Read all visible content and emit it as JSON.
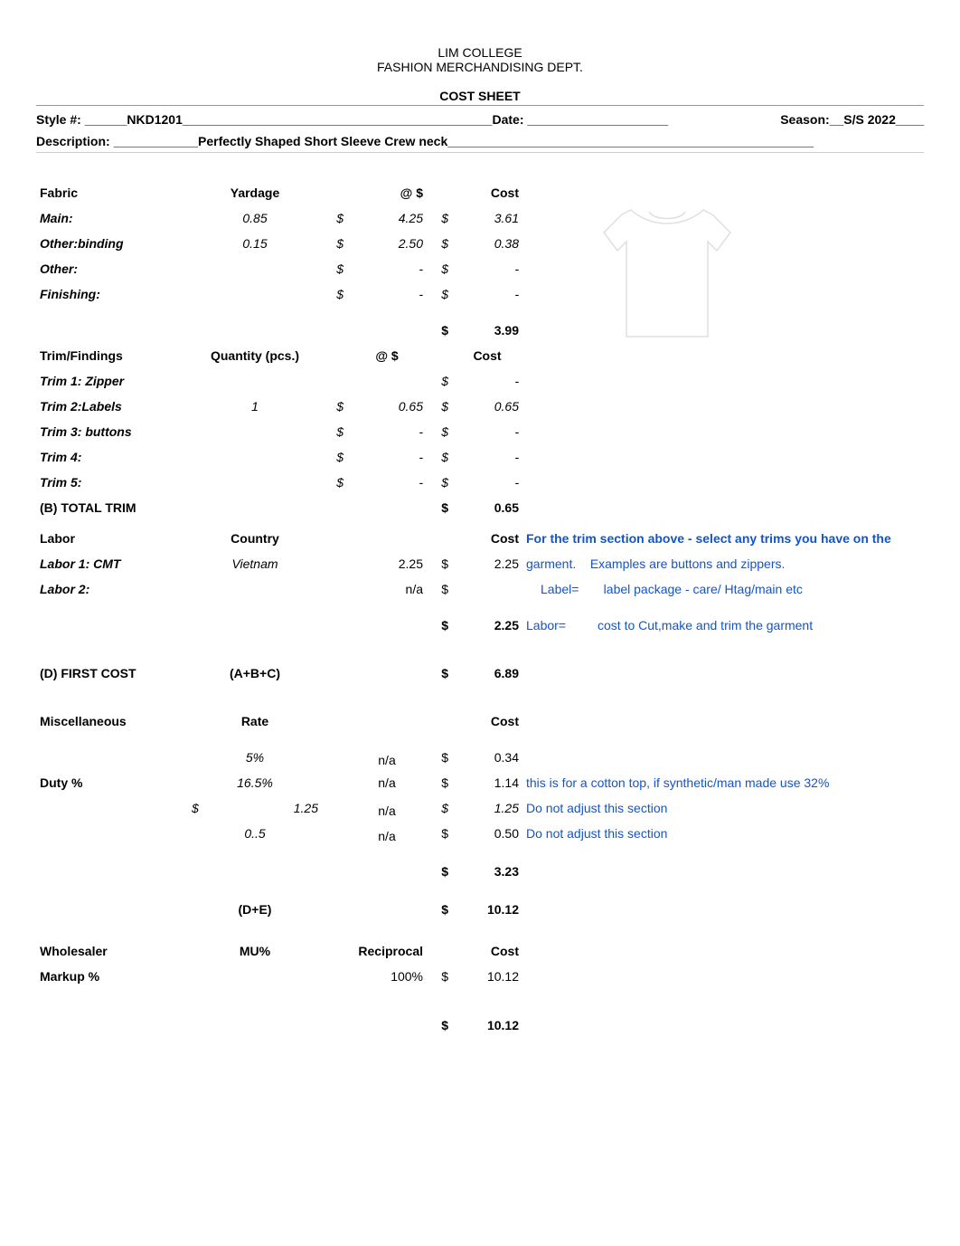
{
  "header": {
    "line1": "LIM COLLEGE",
    "line2": "FASHION MERCHANDISING DEPT."
  },
  "title": "COST SHEET",
  "meta": {
    "style_label": "Style #: ______",
    "style_value": "NKD1201",
    "style_trail": "____________________________________________",
    "date_label": " Date: ____________________",
    "season_label": "Season:__",
    "season_value": "S/S 2022____",
    "desc_label": "Description: ____________",
    "desc_value": "Perfectly Shaped Short Sleeve Crew neck",
    "desc_trail": "____________________________________________________"
  },
  "fabric": {
    "head_fabric": "Fabric",
    "head_yardage": "Yardage",
    "head_at": "@ $",
    "head_cost": "Cost",
    "rows": [
      {
        "label": "Main:",
        "yardage": "0.85",
        "rate": "4.25",
        "cost": "3.61"
      },
      {
        "label": "Other:binding",
        "yardage": "0.15",
        "rate": "2.50",
        "cost": "0.38"
      },
      {
        "label": "Other:",
        "yardage": "",
        "rate": "-",
        "cost": "-"
      },
      {
        "label": "Finishing:",
        "yardage": "",
        "rate": "-",
        "cost": "-"
      }
    ],
    "subtotal_cost": "3.99"
  },
  "trim": {
    "head_trim": "Trim/Findings",
    "head_qty": "Quantity (pcs.)",
    "head_at": "@ $",
    "head_cost": "Cost",
    "rows": [
      {
        "label": "Trim 1: Zipper",
        "qty": "",
        "rate": "",
        "cost": "-"
      },
      {
        "label": "Trim 2:Labels",
        "qty": "1",
        "rate": "0.65",
        "cost": "0.65"
      },
      {
        "label": "Trim 3:  buttons",
        "qty": "",
        "rate": "-",
        "cost": "-"
      },
      {
        "label": "Trim 4:",
        "qty": "",
        "rate": "-",
        "cost": "-"
      },
      {
        "label": "Trim 5:",
        "qty": "",
        "rate": "-",
        "cost": "-"
      }
    ],
    "total_label": "(B) TOTAL TRIM",
    "total_cost": "0.65"
  },
  "labor": {
    "head_labor": "Labor",
    "head_country": "Country",
    "head_cost": "Cost",
    "rows": [
      {
        "label": "Labor 1: CMT",
        "country": "Vietnam",
        "rate": "2.25",
        "cost": "2.25"
      },
      {
        "label": "Labor 2:",
        "country": "",
        "rate": "n/a",
        "cost": ""
      }
    ],
    "subtotal_cost": "2.25",
    "note1a": "For the trim section above -  select any trims you have on the",
    "note1b": "garment.",
    "note1c": "Examples are buttons and zippers.",
    "note2a": "Label=",
    "note2b": "label package -  care/ Htag/main etc",
    "note3a": "Labor=",
    "note3b": "cost to Cut,make and trim the garment"
  },
  "first_cost": {
    "label": "(D) FIRST COST",
    "formula": "(A+B+C)",
    "value": "6.89"
  },
  "misc": {
    "head_misc": "Miscellaneous",
    "head_rate": "Rate",
    "head_cost": "Cost",
    "rows": [
      {
        "rate": "5%",
        "mid": "n/a",
        "cost": "0.34",
        "note": ""
      },
      {
        "label": "Duty %",
        "rate": "16.5%",
        "mid": "n/a",
        "cost": "1.14",
        "note": "this is for a cotton top, if synthetic/man made use 32%"
      },
      {
        "prefix": "$",
        "rate": "1.25",
        "mid": "n/a",
        "cost": "1.25",
        "note": "Do not adjust this section",
        "italic": true
      },
      {
        "rate": "0..5",
        "mid": "n/a",
        "cost": "0.50",
        "note": "Do not adjust this section"
      }
    ],
    "subtotal_cost": "3.23",
    "de_label": "(D+E)",
    "de_value": "10.12"
  },
  "wholesale": {
    "head_wh": "Wholesaler",
    "head_mu": "MU%",
    "head_recip": "Reciprocal",
    "head_cost": "Cost",
    "markup_label": "Markup %",
    "recip_value": "100%",
    "cost_value": "10.12",
    "total_value": "10.12"
  }
}
